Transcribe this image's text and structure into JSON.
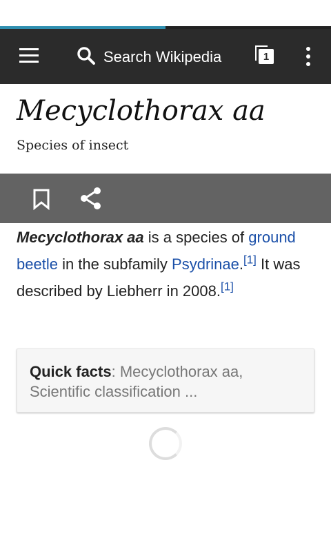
{
  "toolbar": {
    "search_placeholder": "Search Wikipedia",
    "tab_count": "1",
    "progress": 0.5
  },
  "article": {
    "title": "Mecyclothorax aa",
    "description": "Species of insect",
    "lead": {
      "bold_name": "Mecyclothorax aa",
      "text1": " is a species of ",
      "link1": "ground beetle",
      "text2": " in the subfamily ",
      "link2": "Psydrinae",
      "text3": ".",
      "ref1": "[1]",
      "text4": " It was described by Liebherr in 2008.",
      "ref2": "[1]"
    },
    "quick_facts": {
      "label": "Quick facts",
      "separator": ": ",
      "summary": "Mecyclothorax aa, Scientific classification ..."
    }
  },
  "colors": {
    "toolbar_bg": "#2b2b2b",
    "actionbar_bg": "#636363",
    "link": "#1a4fa8",
    "progress": "#2f8fb0"
  }
}
